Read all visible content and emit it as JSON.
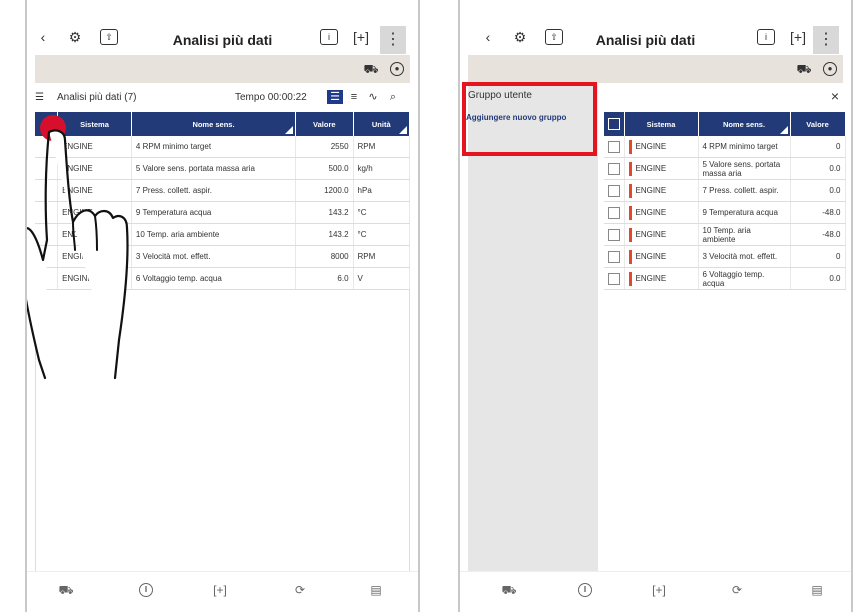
{
  "left": {
    "title": "Analisi più dati",
    "toolbar": {
      "label": "Analisi più dati (7)",
      "time": "Tempo 00:00:22"
    },
    "table": {
      "headers": [
        "",
        "Sistema",
        "Nome sens.",
        "Valore",
        "Unità"
      ],
      "rows": [
        {
          "system": "ENGINE",
          "name": "4 RPM minimo target",
          "value": "2550",
          "unit": "RPM"
        },
        {
          "system": "ENGINE",
          "name": "5 Valore sens. portata massa aria",
          "value": "500.0",
          "unit": "kg/h"
        },
        {
          "system": "ENGINE",
          "name": "7 Press. collett. aspir.",
          "value": "1200.0",
          "unit": "hPa"
        },
        {
          "system": "ENGINE",
          "name": "9 Temperatura acqua",
          "value": "143.2",
          "unit": "°C"
        },
        {
          "system": "ENGINE",
          "name": "10 Temp. aria ambiente",
          "value": "143.2",
          "unit": "°C"
        },
        {
          "system": "ENGINE",
          "name": "3 Velocità mot. effett.",
          "value": "8000",
          "unit": "RPM"
        },
        {
          "system": "ENGINE",
          "name": "6 Voltaggio temp. acqua",
          "value": "6.0",
          "unit": "V"
        }
      ]
    }
  },
  "right": {
    "title": "Analisi più dati",
    "sidebar": {
      "heading": "Gruppo utente",
      "add_item": "Aggiungere nuovo gruppo"
    },
    "close_icon": "×",
    "table": {
      "headers": [
        "",
        "Sistema",
        "Nome sens.",
        "Valore"
      ],
      "rows": [
        {
          "system": "ENGINE",
          "name": "4 RPM minimo target",
          "value": "0"
        },
        {
          "system": "ENGINE",
          "name": "5 Valore sens. portata massa aria",
          "value": "0.0"
        },
        {
          "system": "ENGINE",
          "name": "7 Press. collett. aspir.",
          "value": "0.0"
        },
        {
          "system": "ENGINE",
          "name": "9 Temperatura acqua",
          "value": "-48.0"
        },
        {
          "system": "ENGINE",
          "name": "10 Temp. aria ambiente",
          "value": "-48.0"
        },
        {
          "system": "ENGINE",
          "name": "3 Velocità mot. effett.",
          "value": "0"
        },
        {
          "system": "ENGINE",
          "name": "6 Voltaggio temp. acqua",
          "value": "0.0"
        }
      ]
    }
  },
  "colors": {
    "accent": "#223a78",
    "highlight": "#e4151f",
    "beige": "#e8e2dd",
    "engine_bar": "#e04a2a"
  }
}
